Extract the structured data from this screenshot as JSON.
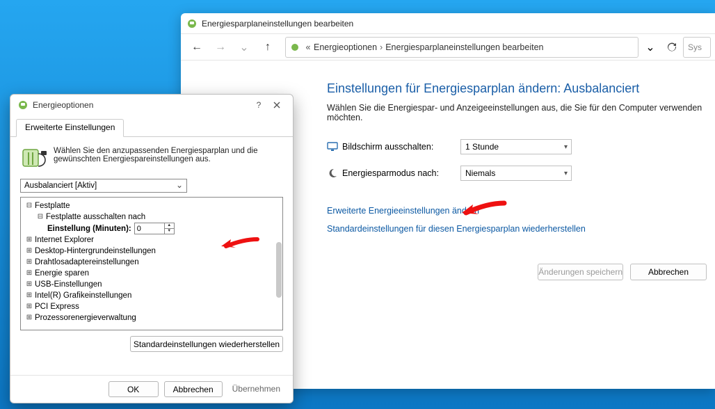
{
  "explorer": {
    "window_title": "Energiesparplaneinstellungen bearbeiten",
    "breadcrumb": {
      "prefix": "«",
      "a": "Energieoptionen",
      "b": "Energiesparplaneinstellungen bearbeiten"
    },
    "search_placeholder": "Sys",
    "page_title": "Einstellungen für Energiesparplan ändern: Ausbalanciert",
    "page_sub": "Wählen Sie die Energiespar- und Anzeigeeinstellungen aus, die Sie für den Computer verwenden möchten.",
    "row1": {
      "label": "Bildschirm ausschalten:",
      "value": "1 Stunde"
    },
    "row2": {
      "label": "Energiesparmodus nach:",
      "value": "Niemals"
    },
    "link_advanced": "Erweiterte Energieeinstellungen ändern",
    "link_restore": "Standardeinstellungen für diesen Energiesparplan wiederherstellen",
    "btn_save": "Änderungen speichern",
    "btn_cancel": "Abbrechen"
  },
  "dialog": {
    "title": "Energieoptionen",
    "tab": "Erweiterte Einstellungen",
    "intro": "Wählen Sie den anzupassenden Energiesparplan und die gewünschten Energiespareinstellungen aus.",
    "plan": "Ausbalanciert [Aktiv]",
    "tree": {
      "n1": "Festplatte",
      "n1a": "Festplatte ausschalten nach",
      "n1a_setting_label": "Einstellung (Minuten):",
      "n1a_setting_value": "0",
      "n2": "Internet Explorer",
      "n3": "Desktop-Hintergrundeinstellungen",
      "n4": "Drahtlosadaptereinstellungen",
      "n5": "Energie sparen",
      "n6": "USB-Einstellungen",
      "n7": "Intel(R) Grafikeinstellungen",
      "n8": "PCI Express",
      "n9": "Prozessorenergieverwaltung"
    },
    "restore_btn": "Standardeinstellungen wiederherstellen",
    "ok": "OK",
    "cancel": "Abbrechen",
    "apply": "Übernehmen"
  }
}
